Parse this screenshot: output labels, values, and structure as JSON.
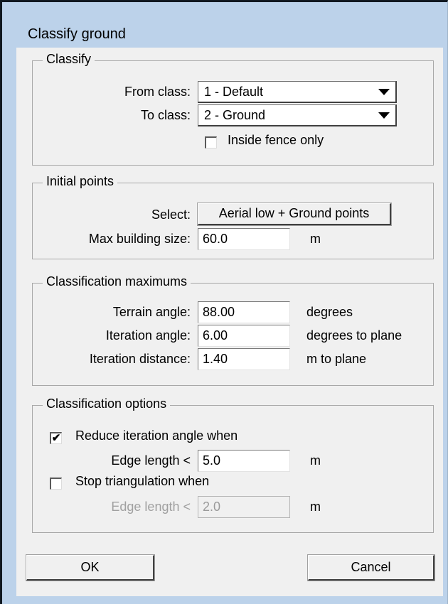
{
  "window": {
    "title": "Classify ground"
  },
  "classify": {
    "title": "Classify",
    "from_label": "From class:",
    "from_value": "1 - Default",
    "to_label": "To class:",
    "to_value": "2 - Ground",
    "inside_fence_label": "Inside fence only",
    "inside_fence_checked": false
  },
  "initial_points": {
    "title": "Initial points",
    "select_label": "Select:",
    "select_button": "Aerial low + Ground points",
    "max_building_label": "Max building size:",
    "max_building_value": "60.0",
    "max_building_unit": "m"
  },
  "maximums": {
    "title": "Classification maximums",
    "terrain_label": "Terrain angle:",
    "terrain_value": "88.00",
    "terrain_unit": "degrees",
    "iter_angle_label": "Iteration angle:",
    "iter_angle_value": "6.00",
    "iter_angle_unit": "degrees to plane",
    "iter_dist_label": "Iteration distance:",
    "iter_dist_value": "1.40",
    "iter_dist_unit": "m  to plane"
  },
  "options": {
    "title": "Classification options",
    "reduce_label": "Reduce iteration angle when",
    "reduce_checked": true,
    "reduce_edge_label": "Edge length <",
    "reduce_edge_value": "5.0",
    "reduce_edge_unit": "m",
    "stop_label": "Stop triangulation when",
    "stop_checked": false,
    "stop_edge_label": "Edge length <",
    "stop_edge_value": "2.0",
    "stop_edge_unit": "m"
  },
  "buttons": {
    "ok": "OK",
    "cancel": "Cancel"
  },
  "check_mark": "✔"
}
